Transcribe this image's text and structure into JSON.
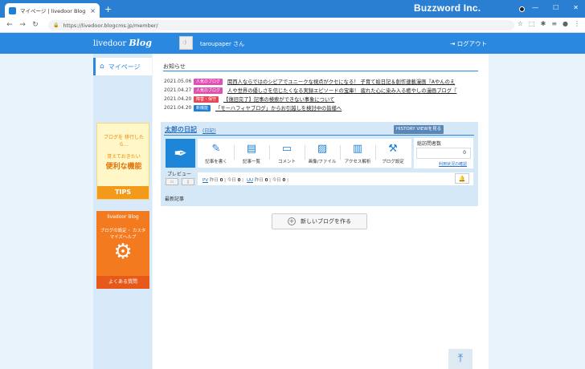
{
  "browser": {
    "tab_title": "マイページ | livedoor Blog",
    "tab_close": "×",
    "new_tab": "+",
    "url": "https://livedoor.blogcms.jp/member/",
    "watermark": "Buzzword Inc.",
    "nav": {
      "back": "←",
      "forward": "→",
      "reload": "↻",
      "lock": "🔒"
    },
    "window_controls": {
      "minimize": "—",
      "maximize": "☐",
      "close": "✕"
    },
    "toolbar_icons": {
      "star": "☆",
      "extensions": "⬚",
      "puzzle": "✱",
      "menu_list": "≡",
      "profile": "●",
      "more": "⋮"
    }
  },
  "header": {
    "logo_text": "livedoor",
    "logo_script": "Blog",
    "username": "taroupaper さん",
    "logout_label": "ログアウト",
    "logout_icon": "⇥"
  },
  "sidebar": {
    "mypage_label": "マイページ",
    "home_icon": "⌂",
    "tips_text": "ブログを 移行したら…",
    "tips_sub": "覚えておきたい",
    "tips_big": "便利な機能",
    "tips_label": "TIPS",
    "faq_logo": "livedoor Blog",
    "faq_text": "ブログの設定・ カスタマイズヘルプ",
    "faq_label": "よくある質問",
    "gear_icon": "⚙"
  },
  "notices": {
    "title": "お知らせ",
    "items": [
      {
        "date": "2021.05.06",
        "badge": "人気のブログ",
        "badge_color": "#e14fb0",
        "text": "関西人ならではのシビアでユニークな視点がクセになる！ 子育て絵日記＆創作連載漫画『Aやんのえ"
      },
      {
        "date": "2021.04.27",
        "badge": "人気のブログ",
        "badge_color": "#e14fb0",
        "text": "人や世界の優しさを信じたくなる実録エピソードの宝庫！ 疲れた心に染み入る癒やしの漫画ブログ『"
      },
      {
        "date": "2021.04.20",
        "badge": "障害・保守",
        "badge_color": "#e8475a",
        "text": "【復旧完了】記事の検索ができない事象について"
      },
      {
        "date": "2021.04.20",
        "badge": "新機能",
        "badge_color": "#1e7fd6",
        "text": "「モーハフィヤブログ」からお引越しを検討中の皆様へ"
      }
    ]
  },
  "blog": {
    "name": "太郎の日記",
    "diary_link": "(日記)",
    "history_button": "HISTORY VIEWを見る",
    "preview_label": "プレビュー",
    "preview_icon": "✒",
    "pc_icon": "▭",
    "sp_icon": "▯",
    "menu": [
      {
        "icon": "✎",
        "label": "記事を書く"
      },
      {
        "icon": "▤",
        "label": "記事一覧"
      },
      {
        "icon": "▭",
        "label": "コメント"
      },
      {
        "icon": "▨",
        "label": "画像/ファイル"
      },
      {
        "icon": "▥",
        "label": "アクセス解析"
      },
      {
        "icon": "⚒",
        "label": "ブログ設定"
      }
    ],
    "visitors_title": "総訪問者数",
    "visitors_count": "0",
    "usage_link": "利用状況の確認",
    "stats": {
      "pv_label": "PV",
      "pv_yesterday_label": "昨日",
      "pv_yesterday": "0",
      "pv_today_label": "今日",
      "pv_today": "0",
      "uu_label": "UU",
      "uu_yesterday_label": "昨日",
      "uu_yesterday": "0",
      "uu_today_label": "今日",
      "uu_today": "0"
    },
    "bell_icon": "🔔",
    "recent_title": "最新記事"
  },
  "new_blog_button": "新しいブログを作る",
  "new_blog_icon": "+",
  "page_top_icon": "⤒"
}
